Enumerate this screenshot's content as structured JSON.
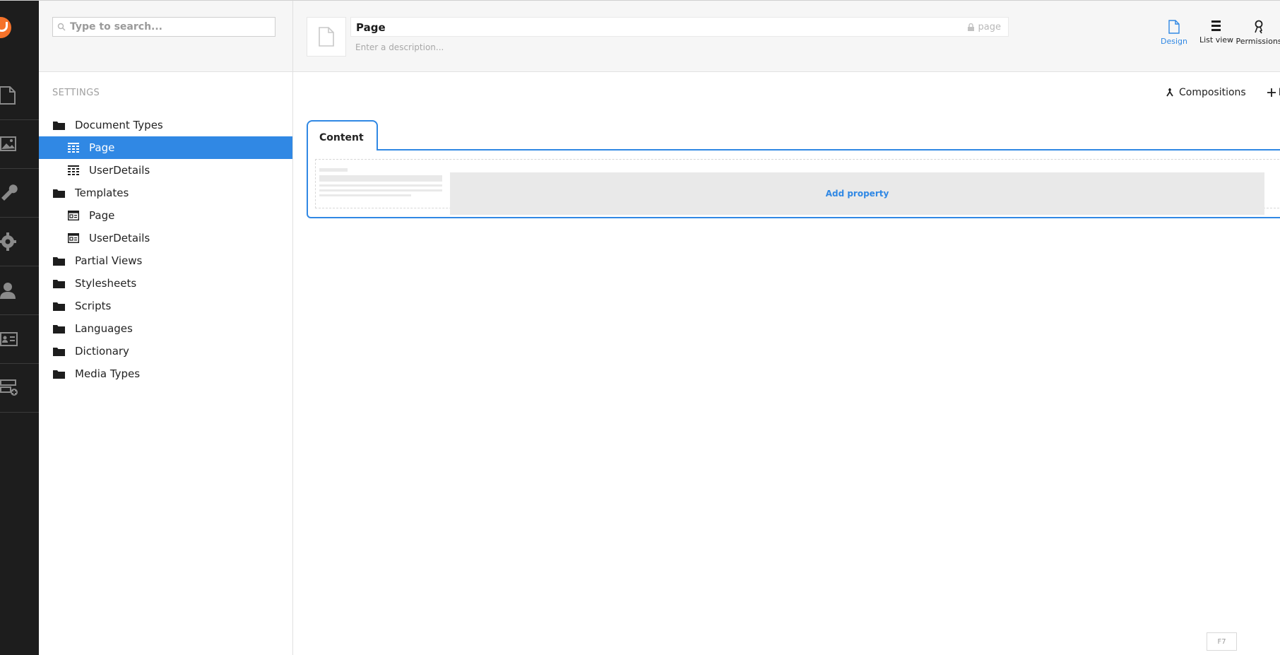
{
  "search": {
    "placeholder": "Type to search..."
  },
  "tree": {
    "section_title": "SETTINGS",
    "items": [
      {
        "label": "Document Types",
        "icon": "folder-icon"
      },
      {
        "label": "Page",
        "icon": "doctype-icon",
        "selected": true
      },
      {
        "label": "UserDetails",
        "icon": "doctype-icon"
      },
      {
        "label": "Templates",
        "icon": "folder-icon"
      },
      {
        "label": "Page",
        "icon": "template-icon"
      },
      {
        "label": "UserDetails",
        "icon": "template-icon"
      },
      {
        "label": "Partial Views",
        "icon": "folder-icon"
      },
      {
        "label": "Stylesheets",
        "icon": "folder-icon"
      },
      {
        "label": "Scripts",
        "icon": "folder-icon"
      },
      {
        "label": "Languages",
        "icon": "folder-icon"
      },
      {
        "label": "Dictionary",
        "icon": "folder-icon"
      },
      {
        "label": "Media Types",
        "icon": "folder-icon"
      }
    ]
  },
  "editor": {
    "name": "Page",
    "alias": "page",
    "description_placeholder": "Enter a description...",
    "views": [
      {
        "label": "Design",
        "icon": "document-icon",
        "active": true
      },
      {
        "label": "List view",
        "icon": "list-icon"
      },
      {
        "label": "Permissions",
        "icon": "key-icon"
      }
    ],
    "toolbar": {
      "compositions": "Compositions",
      "next_label": "R"
    },
    "tab_label": "Content",
    "add_property": "Add property"
  },
  "shortcut_hint": "F7",
  "colors": {
    "accent": "#3088e4",
    "appbar": "#1d1d1d",
    "logo": "#f5722a"
  }
}
